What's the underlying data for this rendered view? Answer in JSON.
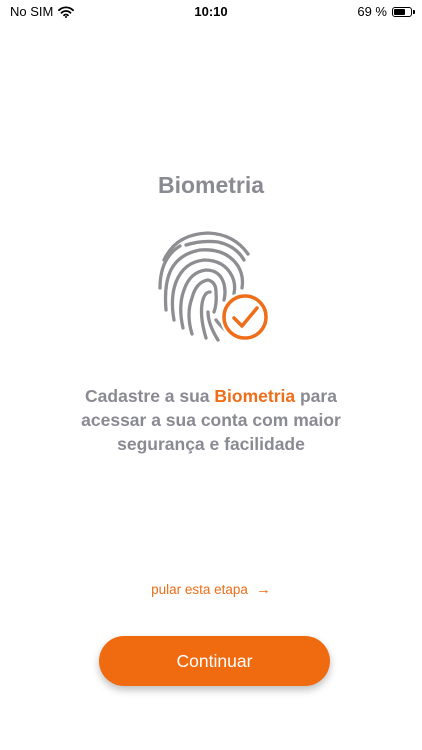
{
  "status_bar": {
    "carrier": "No SIM",
    "time": "10:10",
    "battery_percent": "69 %",
    "battery_level": 0.69
  },
  "title": "Biometria",
  "description": {
    "before": "Cadastre a sua ",
    "highlight": "Biometria",
    "after": " para acessar a sua conta com maior segurança e facilidade"
  },
  "skip": {
    "label": "pular esta etapa",
    "arrow": "→"
  },
  "continue_label": "Continuar",
  "colors": {
    "accent": "#f06a10",
    "text_gray": "#8a8a93",
    "background": "#ffffff"
  },
  "icons": [
    "wifi-icon",
    "battery-icon",
    "fingerprint-icon",
    "check-circle-icon",
    "arrow-right-icon"
  ]
}
